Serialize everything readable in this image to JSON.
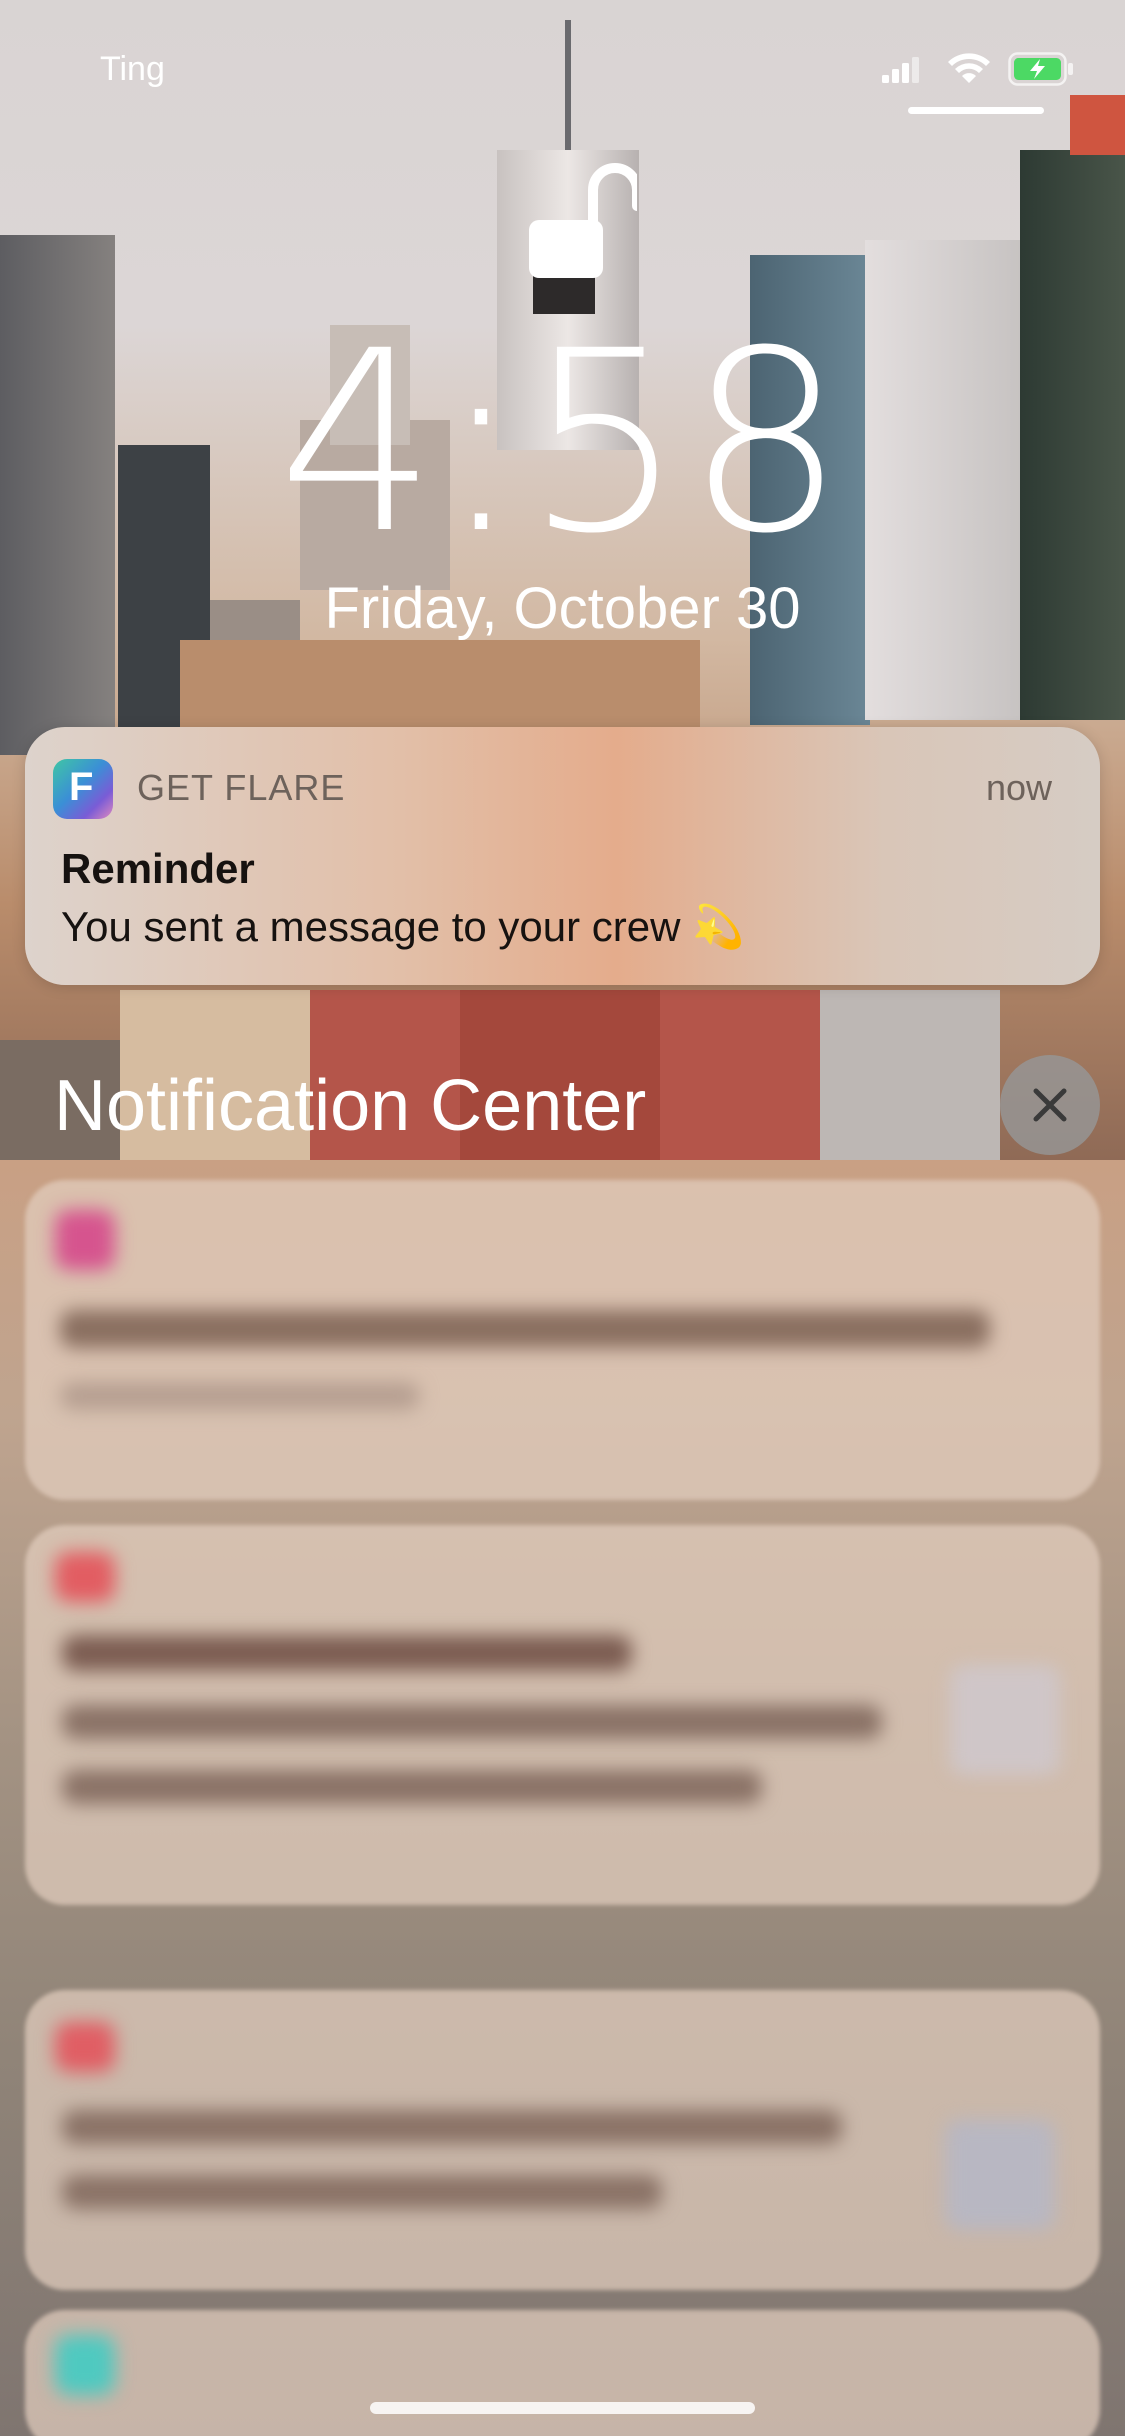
{
  "status_bar": {
    "carrier": "Ting",
    "signal_icon": "cellular-signal-icon",
    "wifi_icon": "wifi-icon",
    "battery_icon": "battery-charging-icon"
  },
  "lock_screen": {
    "lock_icon": "unlocked-padlock-icon",
    "time": "4:58",
    "date": "Friday, October 30"
  },
  "notification": {
    "app_name": "GET FLARE",
    "app_icon_letter": "F",
    "timestamp": "now",
    "title": "Reminder",
    "body": "You sent a message to your crew 💫"
  },
  "notification_center": {
    "title": "Notification Center",
    "close_icon": "close-icon"
  },
  "colors": {
    "notification_accent": "#e4ac8c",
    "battery_green": "#4cd964"
  }
}
